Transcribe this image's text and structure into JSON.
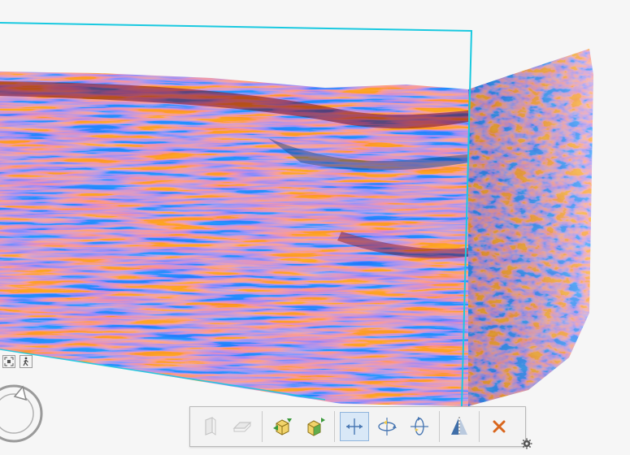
{
  "viewer": {
    "accent_color": "#19c9e0",
    "seismic_colors": {
      "positive": "#8b0a0f",
      "negative": "#0b3d78",
      "neutral": "#f2f2f2"
    }
  },
  "view_controls": {
    "icons": [
      "fit-view-icon",
      "walk-mode-icon"
    ],
    "navigation": "rotate-navigation-ring"
  },
  "toolbar": {
    "groups": [
      {
        "name": "slice-planes",
        "icons": [
          "vertical-plane-icon",
          "horizontal-plane-icon"
        ],
        "enabled": false
      },
      {
        "name": "cube-tools",
        "icons": [
          "cube-move-icon",
          "cube-extrude-icon"
        ],
        "enabled": true
      },
      {
        "name": "section-tools",
        "icons": [
          "move-section-icon",
          "rotate-horizontal-icon",
          "rotate-vertical-icon"
        ],
        "active": "move-section-icon"
      },
      {
        "name": "flip",
        "icons": [
          "flip-section-icon"
        ]
      },
      {
        "name": "close",
        "icons": [
          "close-icon"
        ]
      }
    ],
    "settings_icon": "gear-icon"
  }
}
